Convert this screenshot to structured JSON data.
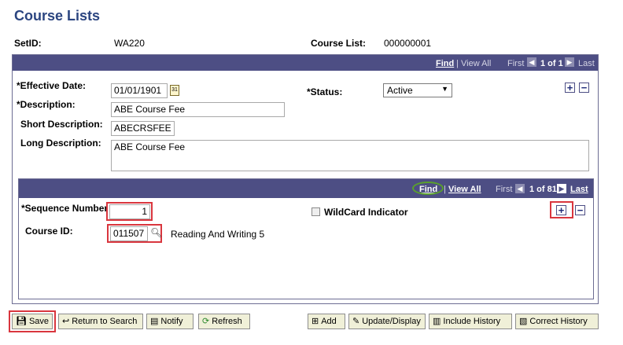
{
  "page": {
    "title": "Course Lists"
  },
  "header": {
    "setid_label": "SetID:",
    "setid_value": "WA220",
    "course_list_label": "Course List:",
    "course_list_value": "000000001"
  },
  "outer_nav": {
    "find": "Find",
    "separator": "|",
    "view_all": "View All",
    "first": "First",
    "range": "1 of 1",
    "last": "Last"
  },
  "form": {
    "effective_date_label": "*Effective Date:",
    "effective_date_value": "01/01/1901",
    "status_label": "*Status:",
    "status_value": "Active",
    "description_label": "*Description:",
    "description_value": "ABE Course Fee",
    "short_description_label": "Short Description:",
    "short_description_value": "ABECRSFEE",
    "long_description_label": "Long Description:",
    "long_description_value": "ABE Course Fee"
  },
  "inner_nav": {
    "find": "Find",
    "separator": "|",
    "view_all": "View All",
    "first": "First",
    "range": "1 of 81",
    "last": "Last"
  },
  "inner_form": {
    "sequence_label": "*Sequence Number",
    "sequence_value": "1",
    "wildcard_label": "WildCard Indicator",
    "course_id_label": "Course ID:",
    "course_id_value": "011507",
    "course_title": "Reading And Writing 5"
  },
  "toolbar": {
    "save": "Save",
    "return_to_search": "Return to Search",
    "notify": "Notify",
    "refresh": "Refresh",
    "add": "Add",
    "update_display": "Update/Display",
    "include_history": "Include History",
    "correct_history": "Correct History"
  },
  "colors": {
    "title": "#2b4580",
    "nav_bar": "#4d4e84",
    "highlight": "#d9363e",
    "find_circle": "#5aa02c",
    "button_bg": "#f0f0d8"
  }
}
